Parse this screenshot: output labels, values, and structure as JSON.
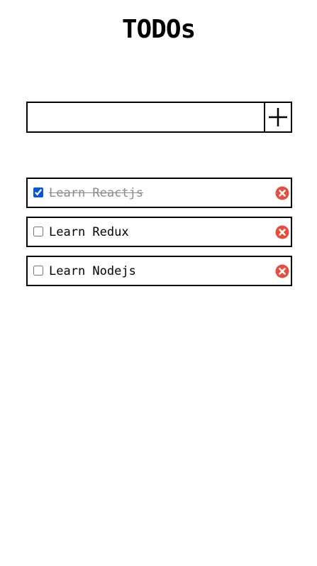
{
  "app": {
    "title": "TODOs"
  },
  "add_form": {
    "input_value": "",
    "button_icon": "plus-icon"
  },
  "todos": [
    {
      "text": "Learn Reactjs",
      "completed": true
    },
    {
      "text": "Learn Redux",
      "completed": false
    },
    {
      "text": "Learn Nodejs",
      "completed": false
    }
  ],
  "colors": {
    "delete_icon": "#e84c3d",
    "completed_text": "#8a8a8a",
    "checkbox_accent": "#0b57d0",
    "border": "#000000"
  },
  "icons": {
    "delete": "close-circle-icon"
  }
}
